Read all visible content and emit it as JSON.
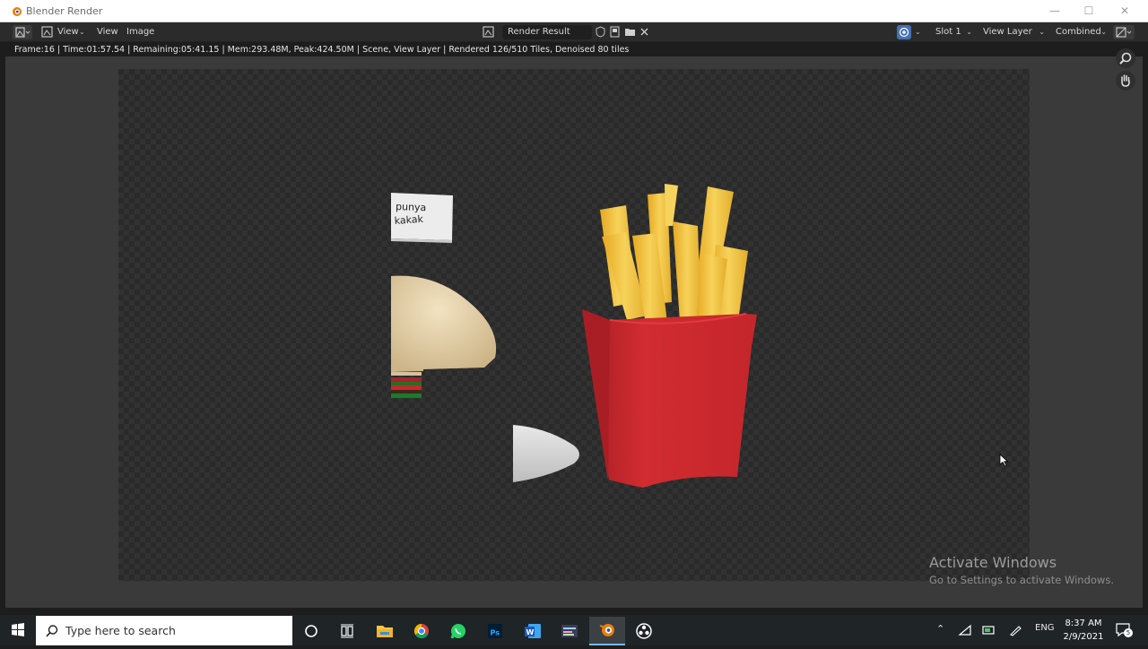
{
  "window": {
    "title": "Blender Render"
  },
  "header": {
    "view_menu_1": "View",
    "view_menu_2": "View",
    "image_menu": "Image",
    "image_name": "Render Result",
    "slot": "Slot 1",
    "view_layer": "View Layer",
    "pass": "Combined"
  },
  "status": {
    "line": "Frame:16 | Time:01:57.54 | Remaining:05:41.15 | Mem:293.48M, Peak:424.50M | Scene, View Layer | Rendered 126/510 Tiles, Denoised 80 tiles"
  },
  "render": {
    "label_line1": "punya",
    "label_line2": "kakak"
  },
  "watermark": {
    "line1": "Activate Windows",
    "line2": "Go to Settings to activate Windows."
  },
  "taskbar": {
    "search_placeholder": "Type here to search",
    "language": "ENG",
    "time": "8:37 AM",
    "date": "2/9/2021",
    "notification_count": "5"
  },
  "colors": {
    "fries_box": "#c8262b",
    "fries": "#f2c23a",
    "title_bar": "#ffffff",
    "header": "#2b2b2b",
    "taskbar": "#1f2426"
  },
  "icons": [
    "blender-logo-icon",
    "image-editor-icon",
    "browse-image-icon",
    "fake-user-icon",
    "new-image-icon",
    "open-image-icon",
    "close-icon",
    "display-channels-icon",
    "zoom-icon",
    "pan-hand-icon",
    "windows-start-icon",
    "search-icon",
    "cortana-icon",
    "task-view-icon",
    "file-explorer-icon",
    "chrome-icon",
    "whatsapp-icon",
    "photoshop-icon",
    "word-icon",
    "app-icon",
    "blender-icon",
    "obs-icon",
    "notifications-icon"
  ]
}
